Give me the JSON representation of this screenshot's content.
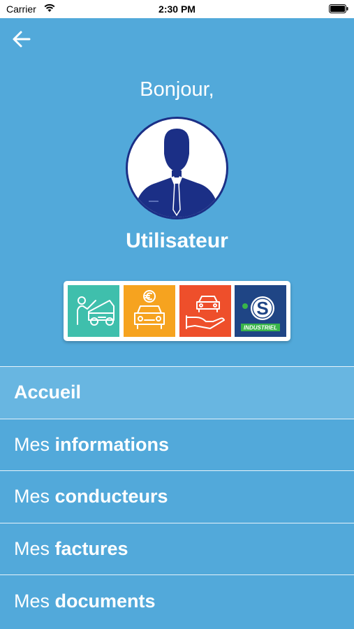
{
  "status_bar": {
    "carrier": "Carrier",
    "time": "2:30 PM"
  },
  "greeting": "Bonjour,",
  "user": {
    "name": "Utilisateur"
  },
  "brand_logos": {
    "industriel_label": "INDUSTRIEL",
    "colors": [
      "#3fbfac",
      "#f6a31f",
      "#ee4f2b",
      "#1f4585"
    ],
    "icons": [
      "mechanic-car-icon",
      "car-euro-icon",
      "hand-car-icon",
      "speedy-industriel-logo"
    ]
  },
  "menu": {
    "items": [
      {
        "prefix": "",
        "bold": "Accueil",
        "active": true
      },
      {
        "prefix": "Mes ",
        "bold": "informations",
        "active": false
      },
      {
        "prefix": "Mes ",
        "bold": "conducteurs",
        "active": false
      },
      {
        "prefix": "Mes ",
        "bold": "factures",
        "active": false
      },
      {
        "prefix": "Mes ",
        "bold": "documents",
        "active": false
      }
    ]
  },
  "colors": {
    "background": "#52a9da",
    "active_item": "#68b6e1",
    "avatar_navy": "#1b2f86"
  }
}
